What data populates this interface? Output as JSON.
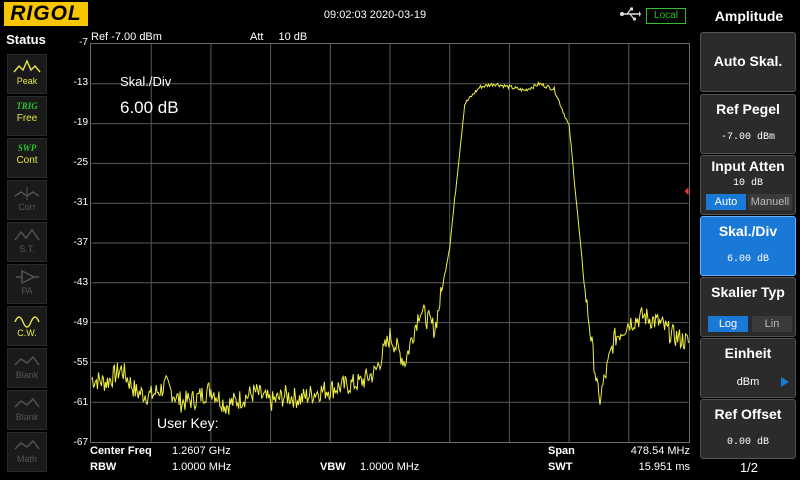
{
  "brand": "RIGOL",
  "datetime": "09:02:03 2020-03-19",
  "local_badge": "Local",
  "status": {
    "title": "Status",
    "buttons": [
      {
        "title": "",
        "label": "Peak",
        "icon": "peak-icon",
        "state": "on"
      },
      {
        "title": "TRIG",
        "label": "Free",
        "icon": "",
        "state": "on"
      },
      {
        "title": "SWP",
        "label": "Cont",
        "icon": "",
        "state": "on"
      },
      {
        "title": "",
        "label": "Corr",
        "icon": "corr-icon",
        "state": "off"
      },
      {
        "title": "",
        "label": "S.T.",
        "icon": "st-icon",
        "state": "off"
      },
      {
        "title": "",
        "label": "PA",
        "icon": "pa-icon",
        "state": "off"
      },
      {
        "title": "",
        "label": "C.W.",
        "icon": "cw-icon",
        "state": "on"
      },
      {
        "title": "",
        "label": "Blank",
        "icon": "blank-icon",
        "state": "off"
      },
      {
        "title": "",
        "label": "Blank",
        "icon": "blank-icon",
        "state": "off"
      },
      {
        "title": "",
        "label": "Math",
        "icon": "math-icon",
        "state": "off"
      }
    ]
  },
  "header": {
    "ref_label": "Ref",
    "ref_value": "-7.00 dBm",
    "att_label": "Att",
    "att_value": "10 dB"
  },
  "overlay": {
    "scale_label": "Skal./Div",
    "scale_value": "6.00 dB",
    "user_key": "User Key:"
  },
  "footer": {
    "center_freq_label": "Center Freq",
    "center_freq_value": "1.2607 GHz",
    "rbw_label": "RBW",
    "rbw_value": "1.0000 MHz",
    "vbw_label": "VBW",
    "vbw_value": "1.0000 MHz",
    "span_label": "Span",
    "span_value": "478.54 MHz",
    "swt_label": "SWT",
    "swt_value": "15.951 ms"
  },
  "menu": {
    "title": "Amplitude",
    "auto_scale": "Auto Skal.",
    "ref_level_label": "Ref Pegel",
    "ref_level_value": "-7.00 dBm",
    "input_atten_label": "Input Atten",
    "input_atten_value": "10 dB",
    "input_atten_opt_auto": "Auto",
    "input_atten_opt_manual": "Manuell",
    "scale_div_label": "Skal./Div",
    "scale_div_value": "6.00 dB",
    "scale_type_label": "Skalier Typ",
    "scale_type_opt_log": "Log",
    "scale_type_opt_lin": "Lin",
    "unit_label": "Einheit",
    "unit_value": "dBm",
    "ref_offset_label": "Ref Offset",
    "ref_offset_value": "0.00 dB",
    "page": "1/2"
  },
  "colors": {
    "trace": "#f0f040",
    "grid": "#5a5a5a",
    "accent": "#1a78d6",
    "local": "#2ec12e",
    "logo": "#f7c600"
  },
  "chart_data": {
    "type": "line",
    "xlabel": "",
    "ylabel": "",
    "ylim": [
      -67,
      -7
    ],
    "y_ticks": [
      "-7",
      "-13",
      "-19",
      "-25",
      "-31",
      "-37",
      "-43",
      "-49",
      "-55",
      "-61",
      "-67"
    ],
    "x_range_mhz": [
      1021.43,
      1499.97
    ],
    "series": [
      {
        "x": [
          1021.4,
          1033.4,
          1045.4,
          1057.3,
          1069.3,
          1081.3,
          1093.2,
          1105.2,
          1117.2,
          1129.1,
          1141.1,
          1153.1,
          1165.0,
          1177.0,
          1189.0,
          1200.9,
          1212.9,
          1224.9,
          1236.8,
          1248.8,
          1260.8,
          1272.7,
          1284.7,
          1296.7,
          1308.6,
          1320.6,
          1332.6,
          1344.5,
          1356.5,
          1368.5,
          1380.4,
          1392.4,
          1404.4,
          1416.3,
          1428.3,
          1440.3,
          1452.2,
          1464.2,
          1476.2,
          1488.1,
          1500.0
        ],
        "y": [
          -57.5,
          -58.0,
          -56.0,
          -59.5,
          -60.0,
          -58.5,
          -61.0,
          -60.5,
          -59.0,
          -61.5,
          -60.5,
          -59.5,
          -61.0,
          -60.0,
          -60.5,
          -59.5,
          -59.0,
          -58.5,
          -58.0,
          -56.5,
          -51.0,
          -55.0,
          -47.0,
          -50.0,
          -37.5,
          -16.0,
          -13.5,
          -13.0,
          -13.5,
          -14.0,
          -13.0,
          -13.8,
          -19.5,
          -43.0,
          -61.0,
          -51.5,
          -49.0,
          -48.0,
          -49.0,
          -51.0,
          -52.0
        ]
      }
    ]
  }
}
